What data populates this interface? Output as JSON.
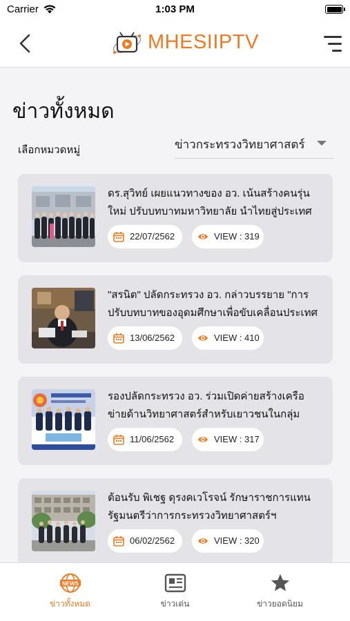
{
  "status_bar": {
    "carrier": "Carrier",
    "time": "1:03 PM",
    "battery_level": 1.0
  },
  "header": {
    "brand": "MHESIIPTV",
    "brand_color": "#f07a22"
  },
  "page_title": "ข่าวทั้งหมด",
  "category": {
    "label": "เลือกหมวดหมู่",
    "selected": "ข่าวกระทรวงวิทยาศาสตร์"
  },
  "news": [
    {
      "title": "ดร.สุวิทย์ เผยแนวทางของ อว. เน้นสร้างคนรุ่นใหม่ ปรับบทบาทมหาวิทยาลัย นำไทยสู่ประเทศนวัตกรรม",
      "date": "22/07/2562",
      "views": "VIEW : 319"
    },
    {
      "title": "\"สรนิต\" ปลัดกระทรวง อว. กล่าวบรรยาย \"การปรับบทบาทของอุดมศึกษาเพื่อขับเคลื่อนประเทศ ภายใต้ก...",
      "date": "13/06/2562",
      "views": "VIEW : 410"
    },
    {
      "title": "รองปลัดกระทรวง อว. ร่วมเปิดค่ายสร้างเครือข่ายด้านวิทยาศาสตร์สำหรับเยาวชนในกลุ่มประเทศอาเซียน+...",
      "date": "11/06/2562",
      "views": "VIEW : 317"
    },
    {
      "title": "ต้อนรับ พิเชฐ ดุรงคเวโรจน์ รักษาราชการแทน รัฐมนตรีว่าการกระทรวงวิทยาศาสตร์ฯ",
      "date": "06/02/2562",
      "views": "VIEW : 320"
    }
  ],
  "tabs": [
    {
      "label": "ข่าวทั้งหมด",
      "icon": "globe-news-icon",
      "active": true
    },
    {
      "label": "ข่าวเด่น",
      "icon": "newspaper-icon",
      "active": false
    },
    {
      "label": "ข่าวยอดนิยม",
      "icon": "star-icon",
      "active": false
    }
  ],
  "logo_text": "NEWS"
}
